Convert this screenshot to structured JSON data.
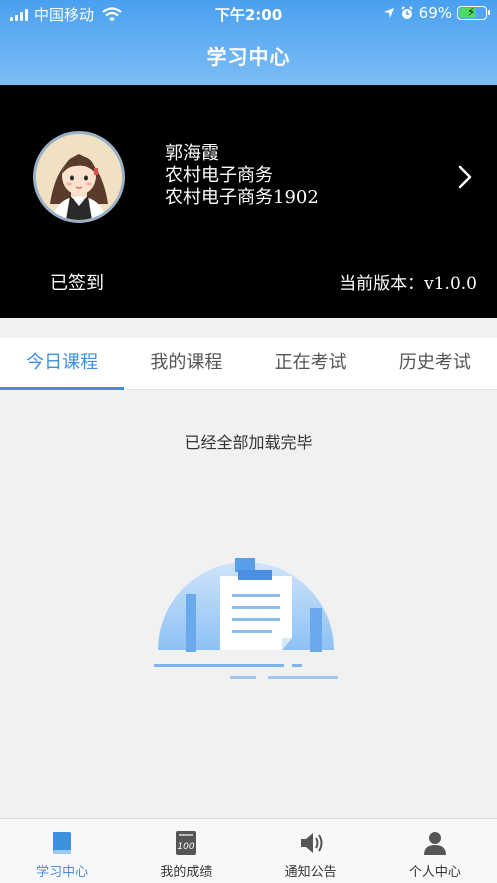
{
  "status_bar": {
    "carrier": "中国移动",
    "time": "下午2:00",
    "battery_percent": "69%",
    "battery_level": 0.69
  },
  "header": {
    "title": "学习中心"
  },
  "profile": {
    "name": "郭海霞",
    "major": "农村电子商务",
    "class_name": "农村电子商务1902",
    "signin_status": "已签到",
    "version_label": "当前版本：",
    "version_value": "v1.0.0"
  },
  "tabs": [
    {
      "label": "今日课程",
      "active": true
    },
    {
      "label": "我的课程",
      "active": false
    },
    {
      "label": "正在考试",
      "active": false
    },
    {
      "label": "历史考试",
      "active": false
    }
  ],
  "content": {
    "loaded_message": "已经全部加载完毕"
  },
  "bottom_nav": [
    {
      "label": "学习中心",
      "icon": "book-icon",
      "active": true
    },
    {
      "label": "我的成绩",
      "icon": "score-icon",
      "active": false
    },
    {
      "label": "通知公告",
      "icon": "speaker-icon",
      "active": false
    },
    {
      "label": "个人中心",
      "icon": "person-icon",
      "active": false
    }
  ],
  "colors": {
    "accent": "#3d8fe0",
    "header_top": "#4aa0f0",
    "profile_bg": "#000000"
  },
  "score_icon_text": "100"
}
